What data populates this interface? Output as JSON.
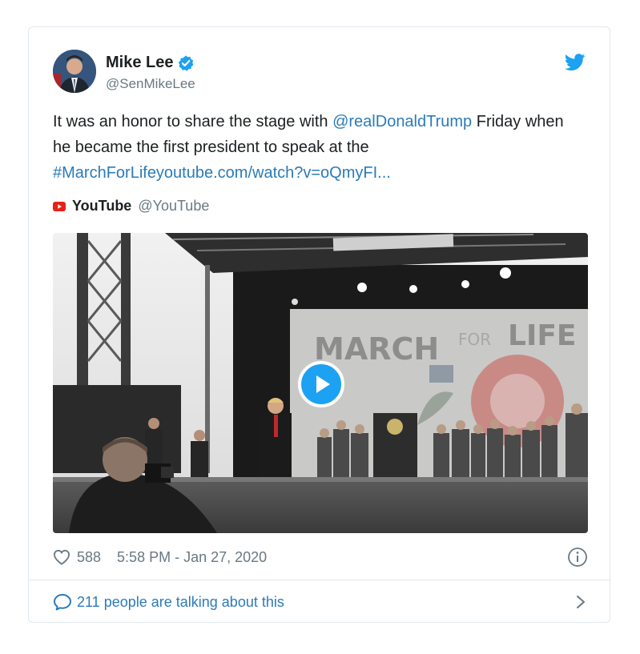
{
  "author": {
    "name": "Mike Lee",
    "handle": "@SenMikeLee",
    "verified_icon": "verified-badge-icon",
    "avatar_icon": "profile-avatar"
  },
  "brand_icon": "twitter-bird-icon",
  "tweet": {
    "text_before": "It was an honor to share the stage with ",
    "mention": "@realDonaldTrump",
    "text_middle": " Friday when he became the first president to speak at the ",
    "hashtag_link": "#MarchForLifeyoutube.com/watch?v=oQmyFI..."
  },
  "source": {
    "name": "YouTube",
    "handle": "@YouTube",
    "icon": "youtube-icon"
  },
  "media": {
    "banner_text": "MARCH FOR LIFE",
    "play_icon": "play-icon"
  },
  "meta": {
    "likes": "588",
    "timestamp": "5:58 PM - Jan 27, 2020",
    "heart_icon": "heart-icon",
    "info_icon": "info-icon"
  },
  "footer": {
    "text": "211 people are talking about this",
    "bubble_icon": "speech-bubble-icon",
    "chevron_icon": "chevron-right-icon"
  },
  "colors": {
    "link": "#2b7bb9",
    "twitter_blue": "#1da1f2",
    "muted": "#697882",
    "border": "#e1e8ed",
    "youtube_red": "#e62117"
  }
}
